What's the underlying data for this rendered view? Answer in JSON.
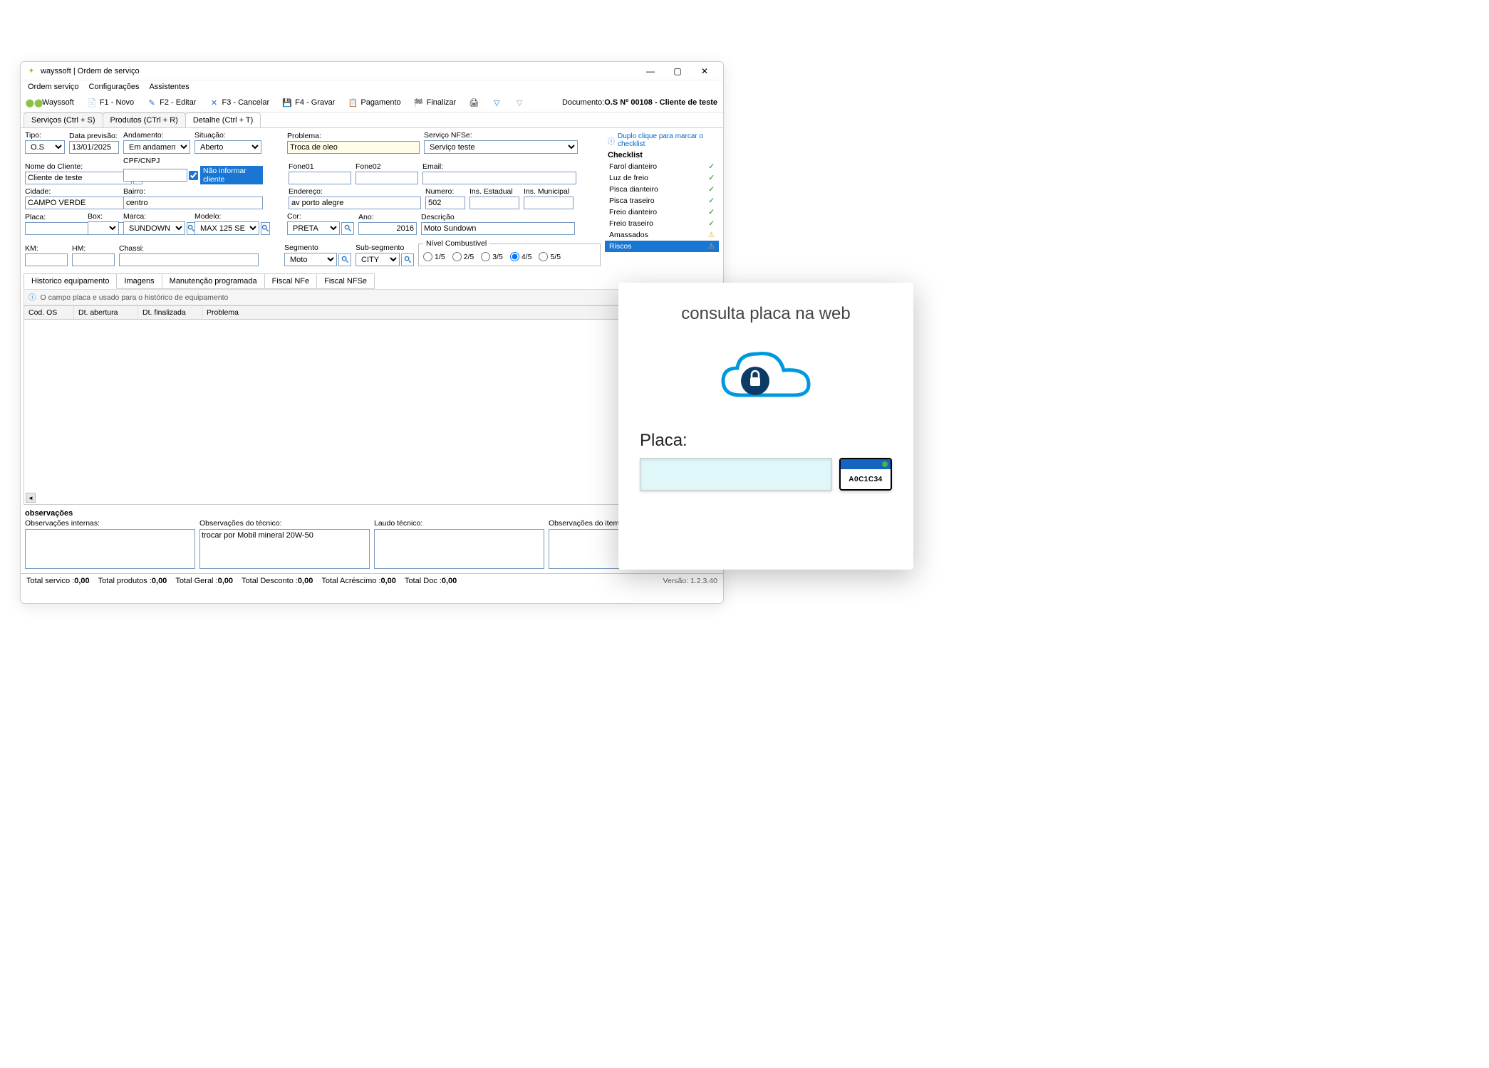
{
  "window": {
    "title": "wayssoft | Ordem de serviço"
  },
  "menubar": {
    "m1": "Ordem serviço",
    "m2": "Configurações",
    "m3": "Assistentes"
  },
  "toolbar": {
    "brand": "Wayssoft",
    "f1": "F1 - Novo",
    "f2": "F2 - Editar",
    "f3": "F3 - Cancelar",
    "f4": "F4 - Gravar",
    "pagamento": "Pagamento",
    "finalizar": "Finalizar",
    "doc_label": "Documento:",
    "doc_value": "O.S Nº 00108 - Cliente de teste"
  },
  "tabs_main": {
    "t1": "Serviços (Ctrl + S)",
    "t2": "Produtos (CTrl + R)",
    "t3": "Detalhe (Ctrl + T)"
  },
  "form": {
    "tipo_lbl": "Tipo:",
    "tipo": "O.S",
    "dataprev_lbl": "Data previsão:",
    "dataprev": "13/01/2025",
    "andamento_lbl": "Andamento:",
    "andamento": "Em andamento",
    "situacao_lbl": "Situação:",
    "situacao": "Aberto",
    "problema_lbl": "Problema:",
    "problema": "Troca de oleo",
    "nfse_lbl": "Serviço NFSe:",
    "nfse": "Serviço teste",
    "nome_lbl": "Nome do Cliente:",
    "nome": "Cliente de teste",
    "cpf_lbl": "CPF/CNPJ",
    "cpf": "",
    "nao_informar": "Não informar cliente",
    "fone1_lbl": "Fone01",
    "fone1": "",
    "fone2_lbl": "Fone02",
    "fone2": "",
    "email_lbl": "Email:",
    "email": "",
    "cidade_lbl": "Cidade:",
    "cidade": "CAMPO VERDE",
    "bairro_lbl": "Bairro:",
    "bairro": "centro",
    "endereco_lbl": "Endereço:",
    "endereco": "av porto alegre",
    "numero_lbl": "Numero:",
    "numero": "502",
    "iest_lbl": "Ins. Estadual",
    "iest": "",
    "imun_lbl": "Ins. Municipal",
    "imun": "",
    "placa_lbl": "Placa:",
    "placa": "",
    "box_lbl": "Box:",
    "box": "",
    "marca_lbl": "Marca:",
    "marca": "SUNDOWN",
    "modelo_lbl": "Modelo:",
    "modelo": "MAX 125 SE",
    "cor_lbl": "Cor:",
    "cor": "PRETA",
    "ano_lbl": "Ano:",
    "ano": "2016",
    "desc_lbl": "Descrição",
    "desc": "Moto Sundown",
    "km_lbl": "KM:",
    "km": "",
    "hm_lbl": "HM:",
    "hm": "",
    "chassi_lbl": "Chassi:",
    "chassi": "",
    "seg_lbl": "Segmento",
    "seg": "Moto",
    "subseg_lbl": "Sub-segmento",
    "subseg": "CITY",
    "fuel_lbl": "Nível Combustível",
    "fuel_opts": {
      "o1": "1/5",
      "o2": "2/5",
      "o3": "3/5",
      "o4": "4/5",
      "o5": "5/5"
    }
  },
  "checklist": {
    "hint": "Duplo clique para marcar o checklist",
    "title": "Checklist",
    "items": [
      {
        "label": "Farol dianteiro",
        "status": "ok"
      },
      {
        "label": "Luz de freio",
        "status": "ok"
      },
      {
        "label": "Pisca dianteiro",
        "status": "ok"
      },
      {
        "label": "Pisca traseiro",
        "status": "ok"
      },
      {
        "label": "Freio dianteiro",
        "status": "ok"
      },
      {
        "label": "Freio traseiro",
        "status": "ok"
      },
      {
        "label": "Amassados",
        "status": "warn"
      },
      {
        "label": "Riscos",
        "status": "warn",
        "selected": true
      }
    ]
  },
  "tabs_sub": {
    "t1": "Historico equipamento",
    "t2": "Imagens",
    "t3": "Manutenção programada",
    "t4": "Fiscal NFe",
    "t5": "Fiscal NFSe"
  },
  "hint_hist": "O campo placa e usado para o histórico de equipamento",
  "grid_cols": {
    "c1": "Cod. OS",
    "c2": "Dt. abertura",
    "c3": "Dt. finalizada",
    "c4": "Problema"
  },
  "obs": {
    "title": "observações",
    "internas_lbl": "Observações internas:",
    "internas": "",
    "tecnico_lbl": "Observações do técnico:",
    "tecnico": "trocar por Mobil mineral 20W-50",
    "laudo_lbl": "Laudo técnico:",
    "laudo": "",
    "item_lbl": "Observações do item:",
    "item": ""
  },
  "status": {
    "s1_lbl": "Total servico :",
    "s1": "0,00",
    "s2_lbl": "Total produtos :",
    "s2": "0,00",
    "s3_lbl": "Total Geral :",
    "s3": "0,00",
    "s4_lbl": "Total Desconto :",
    "s4": "0,00",
    "s5_lbl": "Total Acréscimo :",
    "s5": "0,00",
    "s6_lbl": "Total Doc :",
    "s6": "0,00",
    "version": "Versão: 1.2.3.40"
  },
  "popup": {
    "title": "consulta placa na web",
    "placa_lbl": "Placa:",
    "plate_sample": "A0C1C34"
  }
}
